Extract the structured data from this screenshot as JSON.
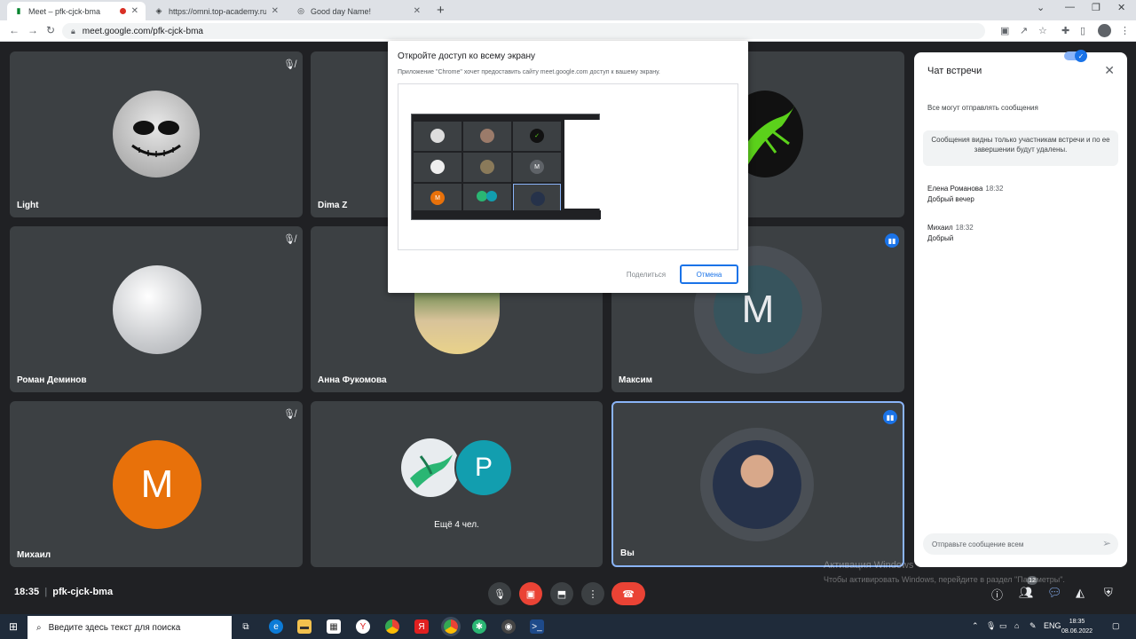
{
  "browser": {
    "tabs": [
      {
        "title": "Meet – pfk-cjck-bma",
        "icon": "meet-icon"
      },
      {
        "title": "https://omni.top-academy.ru/#/p",
        "icon": "web-icon"
      },
      {
        "title": "Good day Name!",
        "icon": "globe-icon"
      }
    ],
    "url": "meet.google.com/pfk-cjck-bma"
  },
  "tiles": [
    {
      "name": "Light",
      "muted": true
    },
    {
      "name": "Dima Z",
      "muted": false
    },
    {
      "name": "",
      "muted": false
    },
    {
      "name": "Роман Деминов",
      "muted": true
    },
    {
      "name": "Анна Фукомова",
      "muted": false
    },
    {
      "name": "Максим",
      "speaking": true,
      "initial": "М"
    },
    {
      "name": "Михаил",
      "muted": true,
      "initial": "М"
    },
    {
      "name": "",
      "others_label": "Ещё 4 чел.",
      "initial": "Р"
    },
    {
      "name": "Вы",
      "speaking": true
    }
  ],
  "dialog": {
    "title": "Откройте доступ ко всему экрану",
    "subtitle": "Приложение \"Chrome\" хочет предоставить сайту meet.google.com доступ к вашему экрану.",
    "share_label": "Поделиться",
    "cancel_label": "Отмена",
    "thumb_initial": "М"
  },
  "chat": {
    "title": "Чат встречи",
    "toggle_label": "Все могут отправлять сообщения",
    "toggle_on": true,
    "notice": "Сообщения видны только участникам встречи и по ее завершении будут удалены.",
    "messages": [
      {
        "author": "Елена Романова",
        "time": "18:32",
        "text": "Добрый вечер"
      },
      {
        "author": "Михаил",
        "time": "18:32",
        "text": "Добрый"
      }
    ],
    "input_placeholder": "Отправьте сообщение всем"
  },
  "meetbar": {
    "time": "18:35",
    "code": "pfk-cjck-bma",
    "people_badge": "12"
  },
  "watermark": {
    "line1": "Активация Windows",
    "line2": "Чтобы активировать Windows, перейдите в раздел \"Параметры\"."
  },
  "taskbar": {
    "search_placeholder": "Введите здесь текст для поиска",
    "lang": "ENG",
    "time": "18:35",
    "date": "08.06.2022"
  },
  "colors": {
    "meet_bg": "#202124",
    "tile_bg": "#3c4043",
    "accent": "#1a73e8",
    "hangup": "#ea4335",
    "avatar_orange": "#e8710a",
    "avatar_teal": "#129eaf"
  }
}
